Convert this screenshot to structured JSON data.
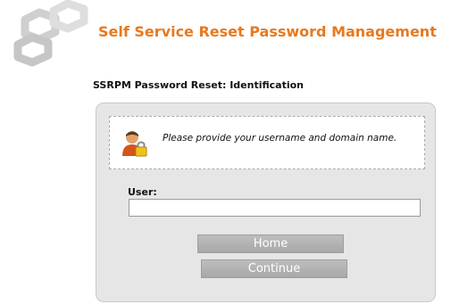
{
  "header": {
    "logo_icon": "hexagon-logo",
    "title": "Self Service Reset Password Management"
  },
  "page": {
    "heading": "SSRPM Password Reset: Identification"
  },
  "panel": {
    "info": {
      "icon": "user-lock-icon",
      "text": "Please provide your username and domain name."
    },
    "user_field": {
      "label": "User:",
      "value": "",
      "placeholder": ""
    },
    "buttons": {
      "home_label": "Home",
      "continue_label": "Continue"
    }
  },
  "colors": {
    "accent": "#e8791e",
    "panel_bg": "#e6e6e6",
    "button_bg": "#b4b4b4"
  }
}
